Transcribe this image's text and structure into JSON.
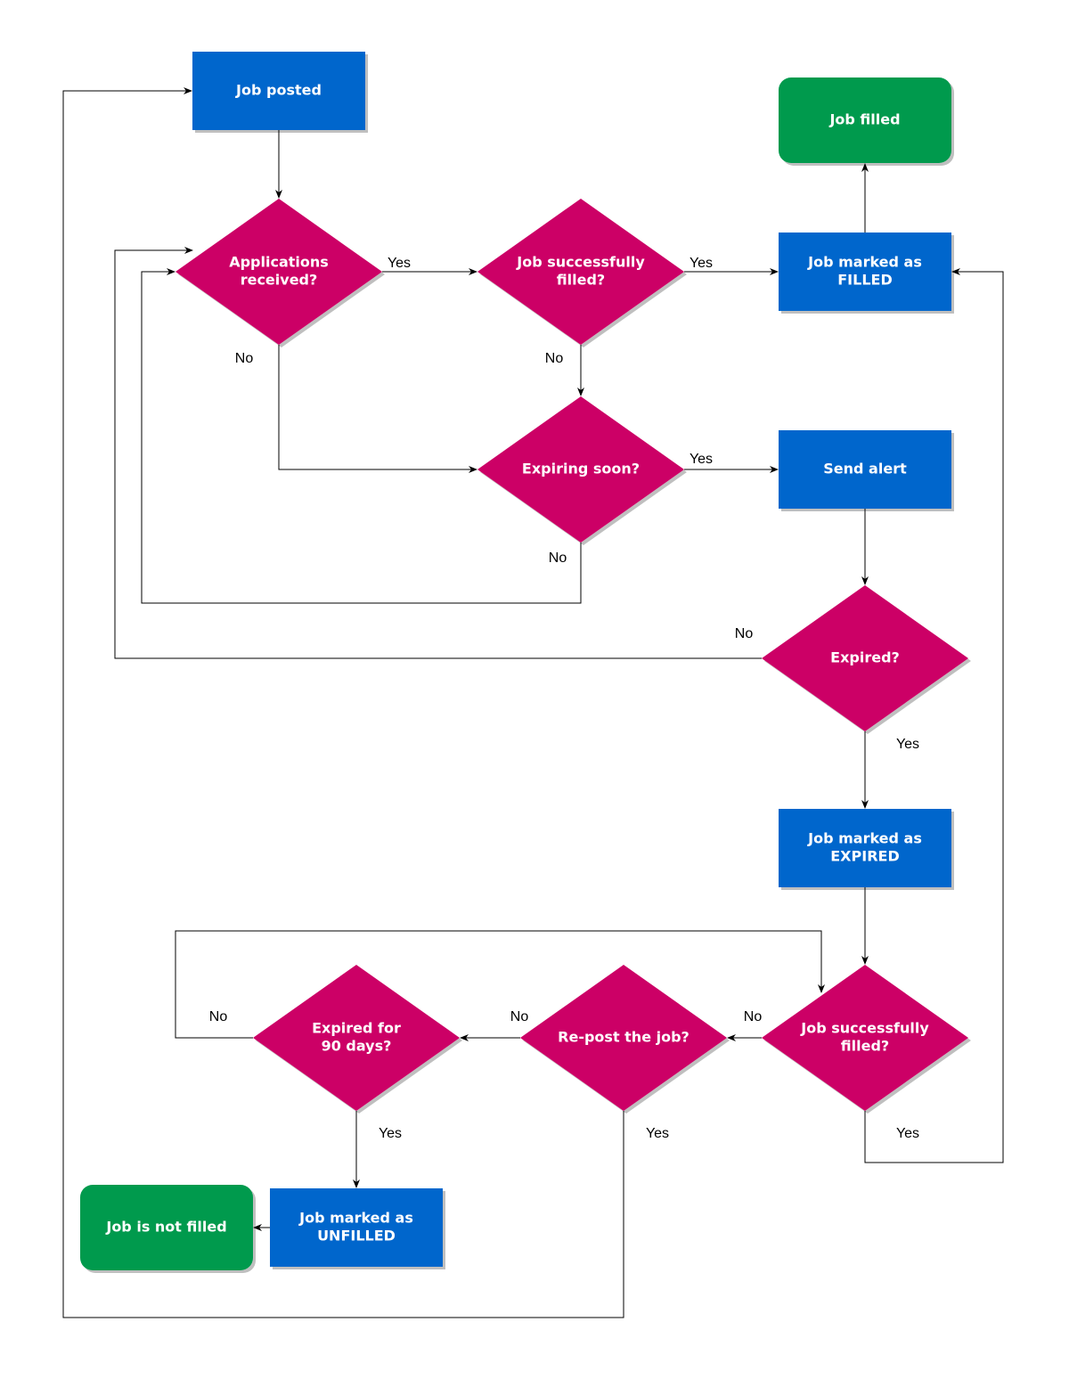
{
  "colors": {
    "process": "#0066CC",
    "decision": "#CC0066",
    "terminal": "#009A4E",
    "edge": "#000000",
    "text": "#FFFFFF"
  },
  "nodes": {
    "job_posted": {
      "type": "process",
      "lines": [
        "Job posted"
      ]
    },
    "applications_received": {
      "type": "decision",
      "lines": [
        "Applications",
        "received?"
      ]
    },
    "job_filled_1": {
      "type": "decision",
      "lines": [
        "Job successfully",
        "filled?"
      ]
    },
    "marked_filled": {
      "type": "process",
      "lines": [
        "Job marked as",
        "FILLED"
      ]
    },
    "job_filled_terminal": {
      "type": "terminal",
      "lines": [
        "Job filled"
      ]
    },
    "expiring_soon": {
      "type": "decision",
      "lines": [
        "Expiring soon?"
      ]
    },
    "send_alert": {
      "type": "process",
      "lines": [
        "Send alert"
      ]
    },
    "expired": {
      "type": "decision",
      "lines": [
        "Expired?"
      ]
    },
    "marked_expired": {
      "type": "process",
      "lines": [
        "Job marked as",
        "EXPIRED"
      ]
    },
    "job_filled_2": {
      "type": "decision",
      "lines": [
        "Job successfully",
        "filled?"
      ]
    },
    "repost": {
      "type": "decision",
      "lines": [
        "Re-post the job?"
      ]
    },
    "expired_90": {
      "type": "decision",
      "lines": [
        "Expired for",
        "90 days?"
      ]
    },
    "marked_unfilled": {
      "type": "process",
      "lines": [
        "Job marked as",
        "UNFILLED"
      ]
    },
    "not_filled_terminal": {
      "type": "terminal",
      "lines": [
        "Job is not filled"
      ]
    }
  },
  "edges": [
    {
      "from": "job_posted",
      "to": "applications_received",
      "label": ""
    },
    {
      "from": "applications_received",
      "to": "job_filled_1",
      "label": "Yes"
    },
    {
      "from": "applications_received",
      "to": "expiring_soon",
      "label": "No"
    },
    {
      "from": "job_filled_1",
      "to": "marked_filled",
      "label": "Yes"
    },
    {
      "from": "job_filled_1",
      "to": "expiring_soon",
      "label": "No"
    },
    {
      "from": "marked_filled",
      "to": "job_filled_terminal",
      "label": ""
    },
    {
      "from": "expiring_soon",
      "to": "send_alert",
      "label": "Yes"
    },
    {
      "from": "expiring_soon",
      "to": "applications_received",
      "label": "No"
    },
    {
      "from": "send_alert",
      "to": "expired",
      "label": ""
    },
    {
      "from": "expired",
      "to": "applications_received",
      "label": "No"
    },
    {
      "from": "expired",
      "to": "marked_expired",
      "label": "Yes"
    },
    {
      "from": "marked_expired",
      "to": "job_filled_2",
      "label": ""
    },
    {
      "from": "job_filled_2",
      "to": "repost",
      "label": "No"
    },
    {
      "from": "job_filled_2",
      "to": "marked_filled",
      "label": "Yes"
    },
    {
      "from": "repost",
      "to": "expired_90",
      "label": "No"
    },
    {
      "from": "repost",
      "to": "job_posted",
      "label": "Yes"
    },
    {
      "from": "expired_90",
      "to": "job_filled_2",
      "label": "No"
    },
    {
      "from": "expired_90",
      "to": "marked_unfilled",
      "label": "Yes"
    },
    {
      "from": "marked_unfilled",
      "to": "not_filled_terminal",
      "label": ""
    }
  ]
}
